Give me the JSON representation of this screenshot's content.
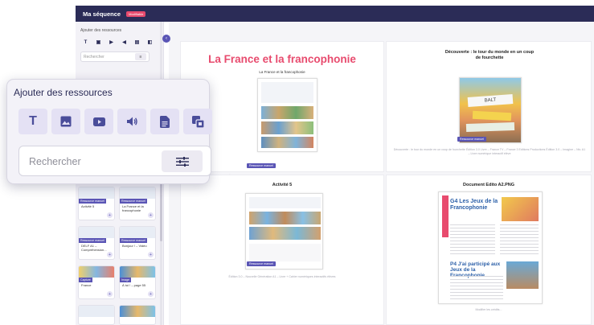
{
  "header": {
    "title": "Ma séquence",
    "badge": "Modifiable",
    "color": "#2b2c57"
  },
  "sidebar": {
    "title": "Ajouter des ressources",
    "search_placeholder": "Rechercher",
    "icons": [
      "text-icon",
      "image-icon",
      "video-icon",
      "audio-icon",
      "document-icon",
      "resource-icon"
    ],
    "cards": [
      {
        "tag": "Ressource manuel",
        "label": "Activité 5"
      },
      {
        "tag": "Ressource manuel",
        "label": "La France et la francophonie"
      },
      {
        "tag": "Ressource manuel",
        "label": "DELF A1 – Compréhension..."
      },
      {
        "tag": "Ressource manuel",
        "label": "Bonjour ! – Vidéo"
      },
      {
        "tag": "Capture",
        "label": "France"
      },
      {
        "tag": "Image",
        "label": "À toi ! – page 55"
      }
    ]
  },
  "popup": {
    "title": "Ajouter des ressources",
    "search_placeholder": "Rechercher",
    "accent": "#4a4d9a"
  },
  "main": {
    "docs": [
      {
        "big_title": "La France et la francophonie",
        "sheet_title": "La France et la francophonie",
        "tag": "Ressource manuel",
        "footer": "Édition 3.0 – Nouvelle Génération A1 – Livre + Cahier numériques interactifs élèves"
      },
      {
        "title": "Découverte : le tour du monde en un coup de fourchette",
        "tag": "Ressource manuel",
        "footer": "Découverte : le tour du monde en un coup de fourchette Édition 3.0 Livre – France TV – France 3 Editions Productions Édition 3.0 – Imagine – Niv. A1 – Livre numérique interactif élève"
      },
      {
        "title": "Activité 5",
        "tag": "Ressource manuel",
        "footer": "Édition 3.0 – Nouvelle Génération A1 – Livre + Cahier numériques interactifs élèves"
      },
      {
        "title": "Document Edito A2.PNG",
        "sheet_heading_1": "G4 Les Jeux de la Francophonie",
        "sheet_heading_2": "P4 J'ai participé aux Jeux de la Francophonie",
        "footer": "Modifier les crédits..."
      }
    ]
  }
}
